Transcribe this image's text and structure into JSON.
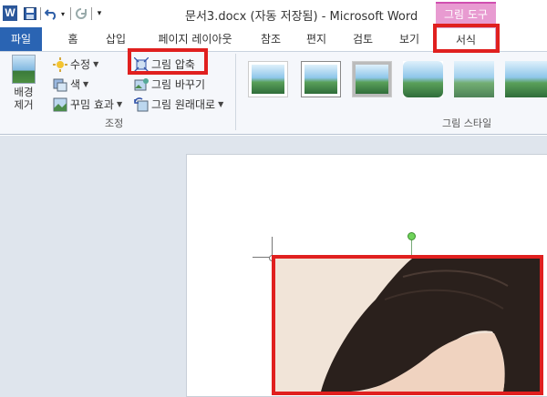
{
  "titlebar": {
    "app_icon_letter": "W",
    "document_title": "문서3.docx (자동 저장됨)  -  Microsoft Word",
    "context_tab_group": "그림 도구"
  },
  "tabs": [
    {
      "label": "파일"
    },
    {
      "label": "홈"
    },
    {
      "label": "삽입"
    },
    {
      "label": "페이지 레이아웃"
    },
    {
      "label": "참조"
    },
    {
      "label": "편지"
    },
    {
      "label": "검토"
    },
    {
      "label": "보기"
    },
    {
      "label": "서식"
    }
  ],
  "ribbon": {
    "adjust_group": {
      "remove_background": "배경\n제거",
      "corrections": "수정",
      "color": "색",
      "artistic_effects": "꾸밈 효과",
      "compress_pictures": "그림 압축",
      "change_picture": "그림 바꾸기",
      "reset_picture": "그림 원래대로",
      "label": "조정"
    },
    "picture_styles_group": {
      "label": "그림 스타일"
    }
  },
  "colors": {
    "file_tab": "#2a64b3",
    "context_tab": "#e89bd1",
    "highlight": "#e0201f",
    "rotate_handle": "#6fd35a"
  }
}
